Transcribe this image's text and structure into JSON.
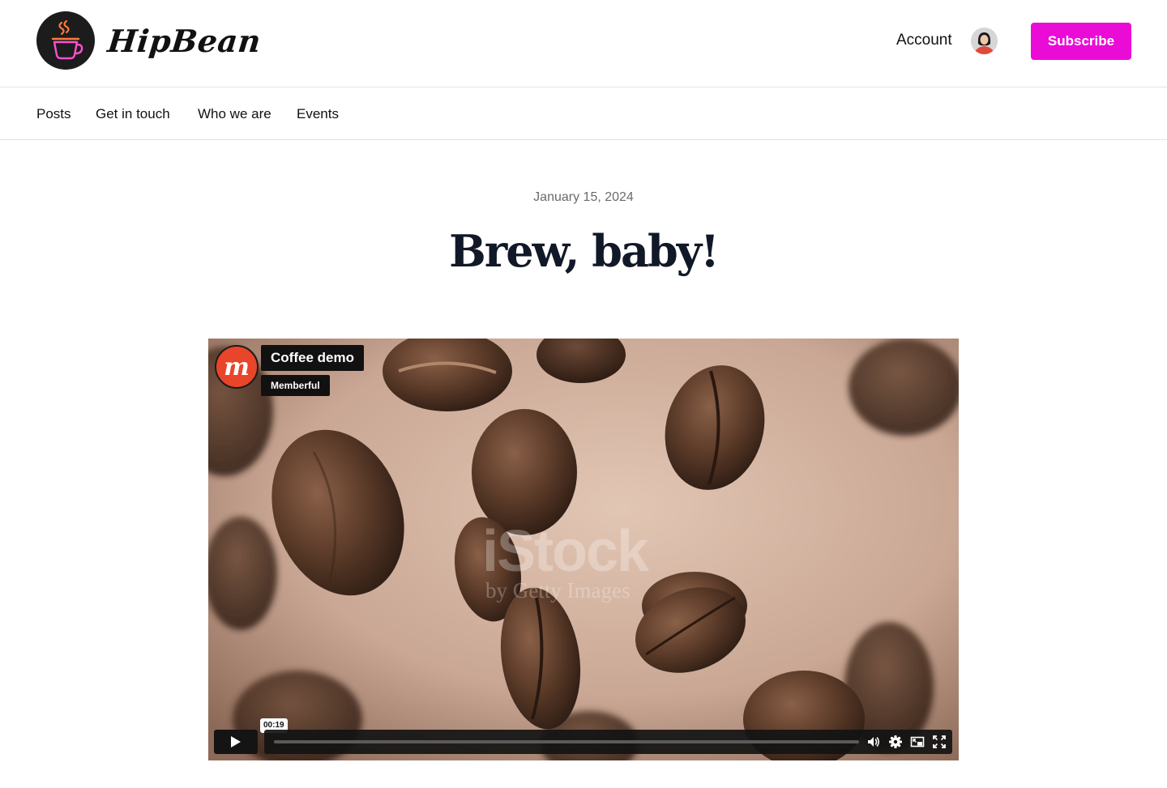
{
  "brand": {
    "name": "HipBean"
  },
  "header": {
    "account_label": "Account",
    "subscribe_label": "Subscribe"
  },
  "nav": {
    "items": [
      {
        "label": "Posts"
      },
      {
        "label": "Get in touch"
      },
      {
        "label": "Who we are"
      },
      {
        "label": "Events"
      }
    ]
  },
  "post": {
    "date": "January 15, 2024",
    "title": "Brew, baby!"
  },
  "video": {
    "title": "Coffee demo",
    "channel": "Memberful",
    "channel_logo_letter": "m",
    "current_time": "00:19",
    "watermark": "iStock",
    "watermark_sub": "by Getty Images",
    "progress": 0
  },
  "colors": {
    "accent": "#ea0bd6",
    "channel_logo": "#e8452a"
  },
  "icons": [
    "coffee-cup-logo-icon",
    "avatar-icon",
    "play-icon",
    "volume-icon",
    "settings-gear-icon",
    "picture-in-picture-icon",
    "fullscreen-icon"
  ]
}
